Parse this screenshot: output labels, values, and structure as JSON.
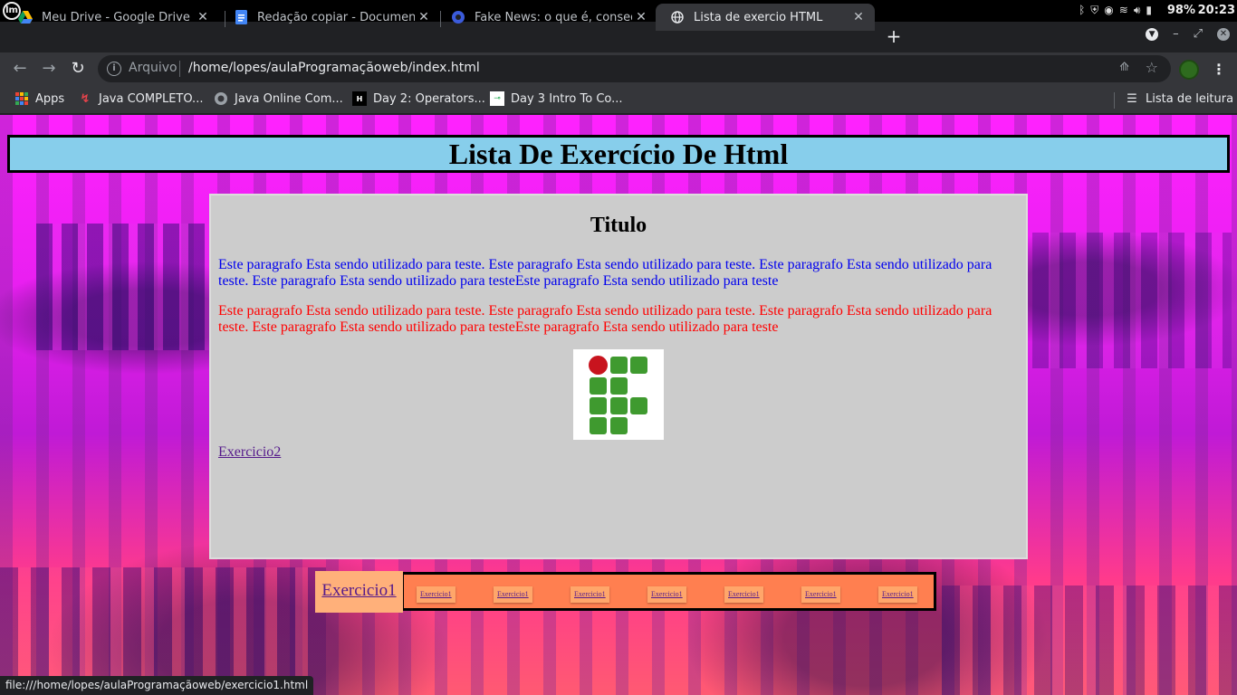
{
  "system": {
    "battery": "98%",
    "clock": "20:23"
  },
  "tabs": [
    {
      "title": "Meu Drive - Google Drive",
      "icon": "google-drive-icon"
    },
    {
      "title": "Redação copiar - Documentos",
      "icon": "google-docs-icon"
    },
    {
      "title": "Fake News: o que é, consequê",
      "icon": "site-favicon"
    },
    {
      "title": "Lista de exercio HTML",
      "icon": "globe-icon"
    }
  ],
  "address_bar": {
    "scheme_label": "Arquivo",
    "url": "/home/lopes/aulaProgramaçãoweb/index.html"
  },
  "bookmarks": [
    {
      "label": "Apps",
      "icon": "apps-grid-icon"
    },
    {
      "label": "Java COMPLETO...",
      "icon": "bookmark-favicon"
    },
    {
      "label": "Java Online Com...",
      "icon": "bookmark-favicon"
    },
    {
      "label": "Day 2: Operators...",
      "icon": "hackerrank-icon"
    },
    {
      "label": "Day 3 Intro To Co...",
      "icon": "bookmark-favicon"
    },
    {
      "label": "Lista de leitura",
      "icon": "reading-list-icon"
    }
  ],
  "page": {
    "header": "Lista De Exercício De Html",
    "content": {
      "title": "Titulo",
      "paragraph_blue": "Este paragrafo Esta sendo utilizado para teste. Este paragrafo Esta sendo utilizado para teste. Este paragrafo Esta sendo utilizado para teste. Este paragrafo Esta sendo utilizado para testeEste paragrafo Esta sendo utilizado para teste",
      "paragraph_red": "Este paragrafo Esta sendo utilizado para teste. Este paragrafo Esta sendo utilizado para teste. Este paragrafo Esta sendo utilizado para teste. Este paragrafo Esta sendo utilizado para testeEste paragrafo Esta sendo utilizado para teste",
      "link": "Exercicio2"
    },
    "footer_nav": {
      "main_link": "Exercicio1",
      "small_links": [
        "Exercicio1",
        "Exercicio1",
        "Exercicio1",
        "Exercicio1",
        "Exercicio1",
        "Exercicio1",
        "Exercicio1"
      ]
    }
  },
  "status_url": "file:///home/lopes/aulaProgramaçãoweb/exercicio1.html",
  "colors": {
    "header_bg": "#87ceeb",
    "content_bg": "#cccccc",
    "footer_bg": "#ff7f50",
    "blue_text": "#0000ee",
    "red_text": "#ff0000",
    "link": "#551a8b"
  }
}
